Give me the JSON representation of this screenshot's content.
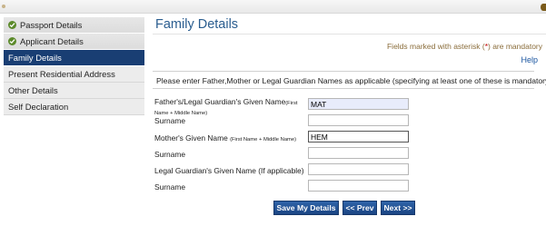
{
  "sidebar": {
    "items": [
      {
        "label": "Passport Details",
        "status": "done"
      },
      {
        "label": "Applicant Details",
        "status": "done"
      },
      {
        "label": "Family Details",
        "status": "active"
      },
      {
        "label": "Present Residential Address",
        "status": "pending"
      },
      {
        "label": "Other Details",
        "status": "pending"
      },
      {
        "label": "Self Declaration",
        "status": "pending"
      }
    ]
  },
  "main": {
    "title": "Family Details",
    "mandatory_note_prefix": "Fields marked with asterisk (",
    "mandatory_note_asterisk": "*",
    "mandatory_note_suffix": ") are mandatory",
    "help_link": "Help",
    "instructions": "Please enter Father,Mother or Legal Guardian Names as applicable (specifying at least one of these is mandatory)."
  },
  "form": {
    "father_given_label": "Father's/Legal Guardian's Given Name",
    "father_given_hint_1": "(First",
    "father_given_hint_2": "Name + Middle Name)",
    "father_given_value": "MAT",
    "father_surname_label": "Surname",
    "father_surname_value": "",
    "mother_given_label": "Mother's Given Name",
    "mother_given_hint": "(First Name + Middle Name)",
    "mother_given_value": "HEM",
    "mother_surname_label": "Surname",
    "mother_surname_value": "",
    "guardian_given_label": "Legal Guardian's Given Name (If applicable)",
    "guardian_given_value": "",
    "guardian_surname_label": "Surname",
    "guardian_surname_value": ""
  },
  "buttons": {
    "save": "Save My Details",
    "prev": "<< Prev",
    "next": "Next >>"
  },
  "colors": {
    "active_nav": "#193e73",
    "title": "#2a5d8f",
    "check": "#5b8a2a",
    "button": "#1f4b8e"
  }
}
